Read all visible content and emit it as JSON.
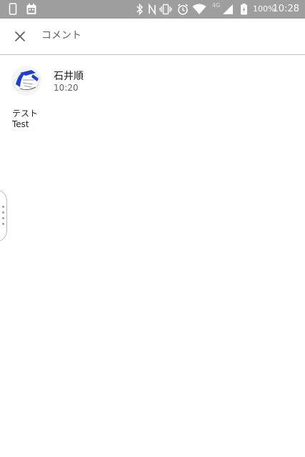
{
  "status_bar": {
    "network_label": "4G",
    "battery_label": "100%",
    "time": "10:28",
    "icons": [
      "phone-icon",
      "calendar-icon",
      "bluetooth-icon",
      "nfc-icon",
      "vibrate-icon",
      "alarm-icon",
      "wifi-icon",
      "signal-icon",
      "battery-icon"
    ]
  },
  "toolbar": {
    "close_icon": "close-icon",
    "title": "コメント"
  },
  "comment": {
    "author": "石井順",
    "time": "10:20",
    "lines": [
      "テスト",
      "Test"
    ]
  },
  "colors": {
    "status_bar_bg": "#9e9e9e",
    "divider": "#bdbdbd",
    "text_primary": "#212121",
    "text_secondary": "#616161",
    "avatar_accent": "#1e3fd6"
  }
}
